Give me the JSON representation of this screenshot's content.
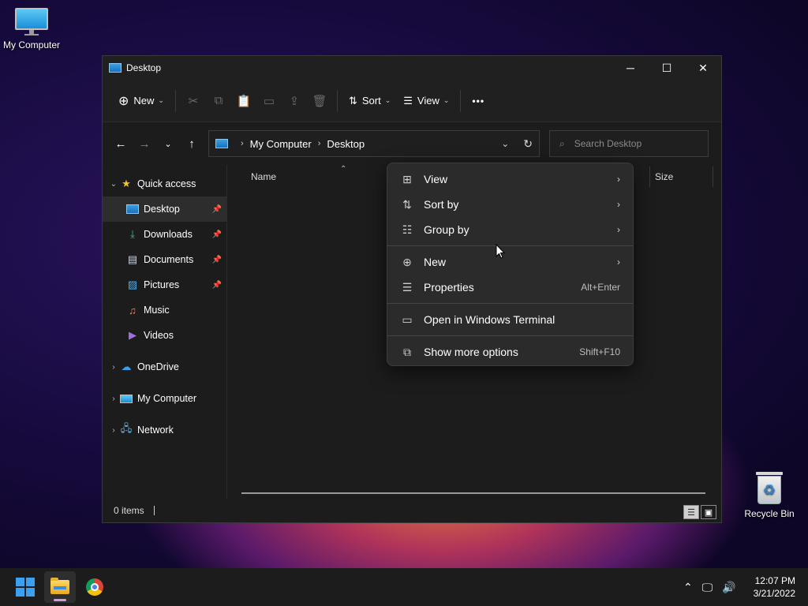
{
  "desktop": {
    "icons": [
      {
        "label": "My Computer"
      },
      {
        "label": "Recycle Bin"
      }
    ]
  },
  "window": {
    "title": "Desktop",
    "controls": {
      "minimize": "─",
      "maximize": "☐",
      "close": "✕"
    }
  },
  "toolbar": {
    "new_label": "New",
    "sort_label": "Sort",
    "view_label": "View",
    "more_label": "•••"
  },
  "navigation": {
    "breadcrumb": [
      "My Computer",
      "Desktop"
    ],
    "search_placeholder": "Search Desktop"
  },
  "sidebar": {
    "quick_access": "Quick access",
    "pinned": [
      {
        "label": "Desktop",
        "icon": "desktop-icon"
      },
      {
        "label": "Downloads",
        "icon": "download-icon"
      },
      {
        "label": "Documents",
        "icon": "document-icon"
      },
      {
        "label": "Pictures",
        "icon": "pictures-icon"
      }
    ],
    "items": [
      {
        "label": "Music",
        "icon": "music-icon"
      },
      {
        "label": "Videos",
        "icon": "videos-icon"
      }
    ],
    "roots": [
      {
        "label": "OneDrive",
        "icon": "cloud-icon"
      },
      {
        "label": "My Computer",
        "icon": "computer-icon"
      },
      {
        "label": "Network",
        "icon": "network-icon"
      }
    ]
  },
  "columns": {
    "name": "Name",
    "size": "Size"
  },
  "status": {
    "items_text": "0 items"
  },
  "context_menu": {
    "items": [
      {
        "label": "View",
        "icon": "grid-icon",
        "submenu": true
      },
      {
        "label": "Sort by",
        "icon": "sort-icon",
        "submenu": true
      },
      {
        "label": "Group by",
        "icon": "group-icon",
        "submenu": true
      },
      {
        "label": "New",
        "icon": "plus-circle-icon",
        "submenu": true
      },
      {
        "label": "Properties",
        "icon": "properties-icon",
        "shortcut": "Alt+Enter"
      },
      {
        "label": "Open in Windows Terminal",
        "icon": "terminal-icon"
      },
      {
        "label": "Show more options",
        "icon": "more-options-icon",
        "shortcut": "Shift+F10"
      }
    ]
  },
  "taskbar": {
    "time": "12:07 PM",
    "date": "3/21/2022"
  },
  "colors": {
    "accent": "#0078d4",
    "window_bg": "#1c1c1c",
    "menu_bg": "#2b2b2b"
  }
}
